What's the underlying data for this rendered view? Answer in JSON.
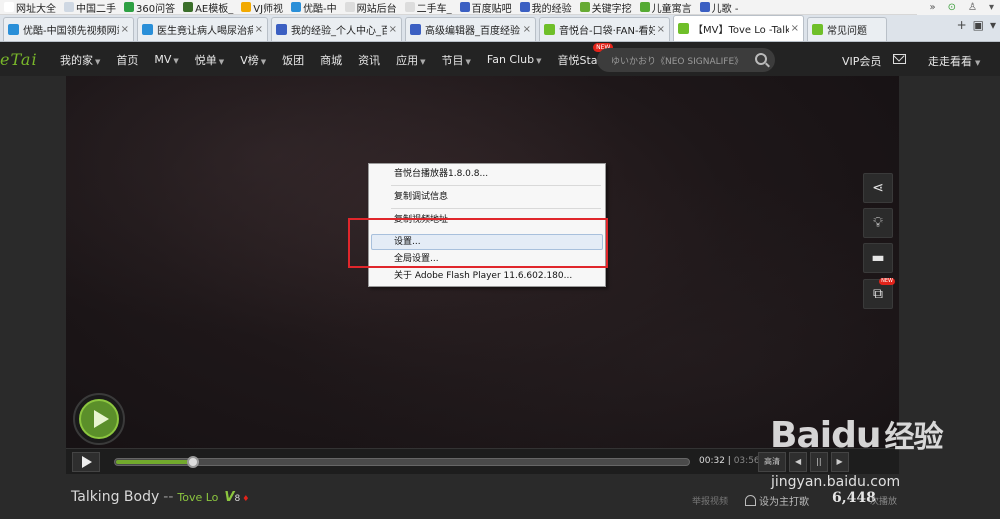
{
  "bookmarks": [
    {
      "label": "网址大全",
      "color": "#ffffff"
    },
    {
      "label": "中国二手",
      "color": "#cfd8e3"
    },
    {
      "label": "360问答",
      "color": "#2ea043"
    },
    {
      "label": "AE模板_",
      "color": "#3a6e2a"
    },
    {
      "label": "VJ师视",
      "color": "#f2a900"
    },
    {
      "label": "优酷-中",
      "color": "#2a8fd8"
    },
    {
      "label": "网站后台",
      "color": "#dcdcdc"
    },
    {
      "label": "二手车_",
      "color": "#dcdcdc"
    },
    {
      "label": "百度贴吧",
      "color": "#3b5fc2"
    },
    {
      "label": "我的经验",
      "color": "#3b5fc2"
    },
    {
      "label": "关键字挖",
      "color": "#66aa33"
    },
    {
      "label": "儿童寓言",
      "color": "#55aa33"
    },
    {
      "label": "儿歌 -",
      "color": "#3b5fc2"
    }
  ],
  "browser_tabs": [
    {
      "label": "优酷-中国领先视频网站",
      "color": "#2a8fd8",
      "active": false
    },
    {
      "label": "医生竟让病人喝尿治病",
      "color": "#2a8fd8",
      "active": false
    },
    {
      "label": "我的经验_个人中心_百度",
      "color": "#3b5fc2",
      "active": false
    },
    {
      "label": "高级编辑器_百度经验",
      "color": "#3b5fc2",
      "active": false
    },
    {
      "label": "音悦台-口袋·FAN-看好",
      "color": "#6fbf29",
      "active": false
    },
    {
      "label": "【MV】Tove Lo -Talk",
      "color": "#6fbf29",
      "active": true
    },
    {
      "label": "常见问题",
      "color": "#6fbf29",
      "active": false
    }
  ],
  "site": {
    "logo": "YinYueTai",
    "logo_visible": "eTai",
    "nav": [
      {
        "label": "我的家",
        "dropdown": true
      },
      {
        "label": "首页",
        "dropdown": false
      },
      {
        "label": "MV",
        "dropdown": true
      },
      {
        "label": "悦单",
        "dropdown": true
      },
      {
        "label": "V榜",
        "dropdown": true
      },
      {
        "label": "饭团",
        "dropdown": false
      },
      {
        "label": "商城",
        "dropdown": false
      },
      {
        "label": "资讯",
        "dropdown": false
      },
      {
        "label": "应用",
        "dropdown": true
      },
      {
        "label": "节目",
        "dropdown": true
      },
      {
        "label": "Fan Club",
        "dropdown": true
      },
      {
        "label": "音悦Stage",
        "dropdown": false,
        "badge": "NEW"
      }
    ],
    "search_placeholder": "ゆいかおり《NEO SIGNALIFE》",
    "vip_label": "VIP会员",
    "user_label": "走走看看"
  },
  "context_menu": {
    "items": [
      {
        "label": "音悦台播放器1.8.0.8..."
      },
      {
        "label": "复制调试信息"
      },
      {
        "label": "复制视频地址"
      },
      {
        "label": "设置..."
      },
      {
        "label": "全局设置..."
      },
      {
        "label": "关于 Adobe Flash Player 11.6.602.180..."
      }
    ],
    "highlighted": "设置..."
  },
  "side_tools": [
    {
      "name": "share",
      "icon": "share-icon"
    },
    {
      "name": "light",
      "icon": "lightbulb-icon"
    },
    {
      "name": "comment",
      "icon": "comment-icon"
    },
    {
      "name": "popout",
      "icon": "popout-icon",
      "badge": "NEW"
    }
  ],
  "player": {
    "current_time": "00:32",
    "duration": "03:56",
    "progress": 0.136,
    "controls": [
      "高清",
      "◀",
      "||",
      "▶"
    ]
  },
  "video": {
    "title": "Talking Body",
    "separator": "--",
    "artist": "Tove Lo",
    "v_badge": "V",
    "v_level": "8",
    "report_label": "举报视频",
    "set_hit_label": "设为主打歌",
    "play_count": "6,448",
    "play_count_unit": "次播放"
  },
  "watermark": {
    "brand": "Baidu",
    "brand_cn": "经验",
    "url": "jingyan.baidu.com"
  },
  "colors": {
    "accent": "#8cc63f",
    "highlight_box": "#e0262b",
    "badge_red": "#e2231a"
  }
}
